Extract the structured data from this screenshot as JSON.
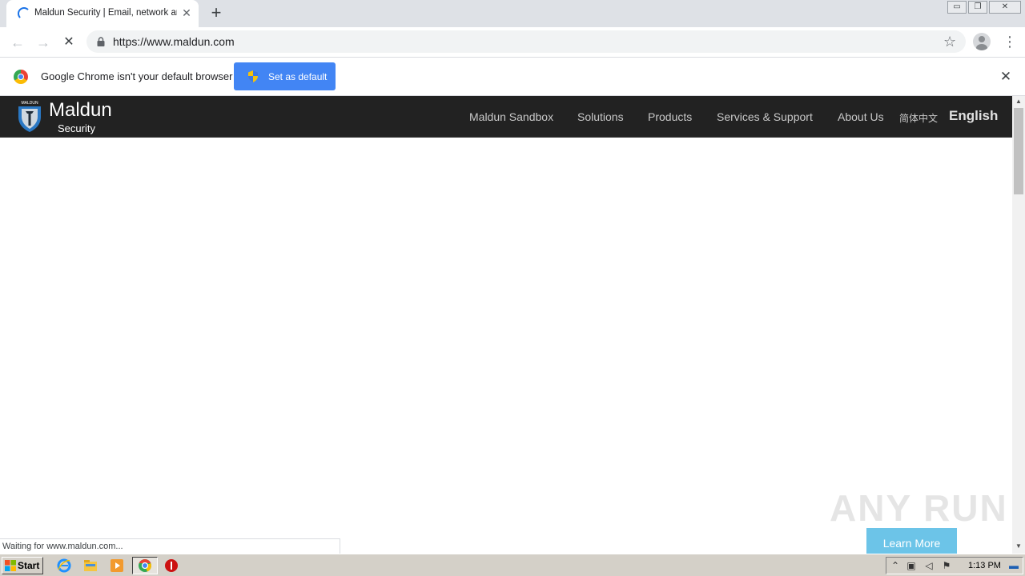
{
  "browser": {
    "tab_title": "Maldun Security | Email, network and",
    "tab_close": "✕",
    "new_tab": "+",
    "window_controls": {
      "minimize": "▭",
      "restore": "❐",
      "close": "✕"
    },
    "url": "https://www.maldun.com",
    "back_icon": "←",
    "forward_icon": "→",
    "stop_icon": "✕",
    "star_icon": "☆",
    "menu_icon": "⋮"
  },
  "infobar": {
    "message": "Google Chrome isn't your default browser",
    "button_label": "Set as default",
    "close": "✕"
  },
  "site": {
    "logo_badge": "MALDUN",
    "logo_name": "Maldun",
    "logo_sub": "Security",
    "nav": [
      "Maldun Sandbox",
      "Solutions",
      "Products",
      "Services & Support",
      "About Us",
      "简体中文",
      "English"
    ]
  },
  "overlay": {
    "watermark": "ANY RUN",
    "learn_more": "Learn More"
  },
  "status_bar": "Waiting for www.maldun.com...",
  "taskbar": {
    "start_label": "Start",
    "clock": "1:13 PM"
  },
  "colors": {
    "site_header": "#222222",
    "infobar_button": "#4285f4",
    "learn_more": "#6cc4e8"
  }
}
